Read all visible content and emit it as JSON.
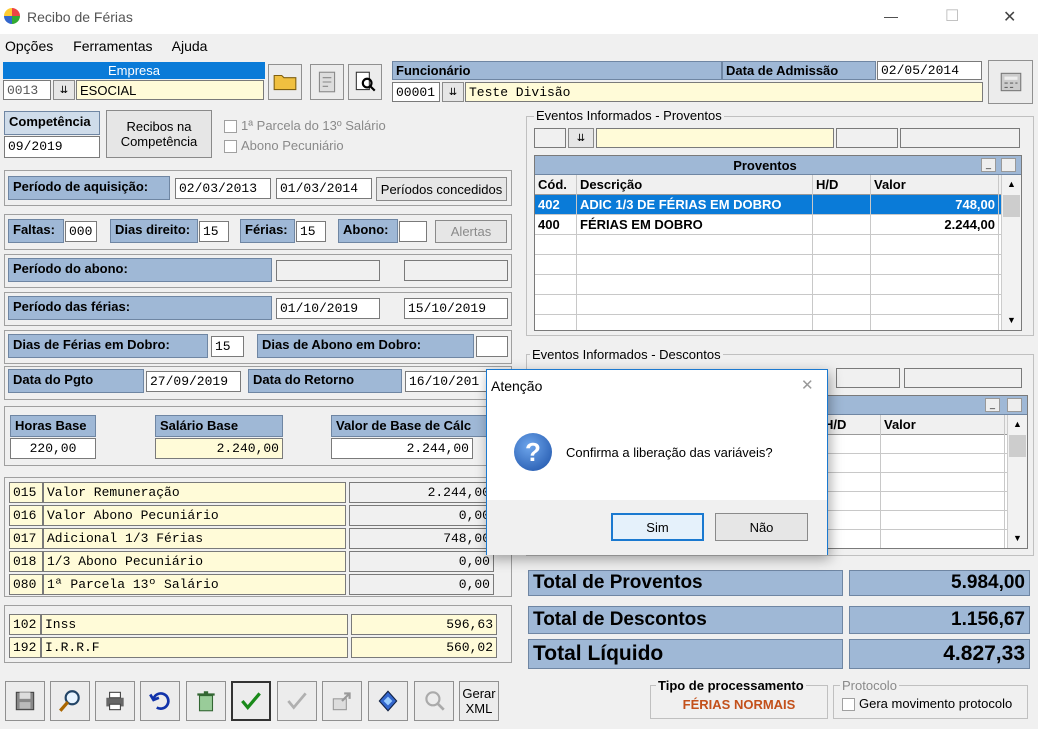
{
  "window": {
    "title": "Recibo de Férias",
    "minimize": "—",
    "maximize": "☐",
    "close": "✕"
  },
  "menu": [
    "Opções",
    "Ferramentas",
    "Ajuda"
  ],
  "empresa": {
    "header": "Empresa",
    "code": "0013",
    "name": "ESOCIAL"
  },
  "funcionario": {
    "header": "Funcionário",
    "code": "00001",
    "name": "Teste Divisão",
    "admissao_label": "Data de Admissão",
    "admissao": "02/05/2014"
  },
  "competencia": {
    "label": "Competência",
    "value": "09/2019",
    "recibos_btn": "Recibos na Competência",
    "parcela13": "1ª Parcela do 13º Salário",
    "abono": "Abono Pecuniário"
  },
  "aquisicao": {
    "label": "Período de aquisição:",
    "start": "02/03/2013",
    "end": "01/03/2014",
    "btn": "Períodos concedidos"
  },
  "dias": {
    "faltas_label": "Faltas:",
    "faltas": "000",
    "direito_label": "Dias direito:",
    "direito": "15",
    "ferias_label": "Férias:",
    "ferias": "15",
    "abono_label": "Abono:",
    "abono": "",
    "alertas_btn": "Alertas"
  },
  "abono_periodo": {
    "label": "Período do abono:",
    "start": "",
    "end": ""
  },
  "ferias_periodo": {
    "label": "Período das férias:",
    "start": "01/10/2019",
    "end": "15/10/2019"
  },
  "dobro": {
    "ferias_label": "Dias de Férias em Dobro:",
    "ferias": "15",
    "abono_label": "Dias de Abono em Dobro:",
    "abono": ""
  },
  "pagamento": {
    "pgto_label": "Data do Pgto",
    "pgto": "27/09/2019",
    "retorno_label": "Data do Retorno",
    "retorno": "16/10/201"
  },
  "base": {
    "horas_label": "Horas Base",
    "horas": "220,00",
    "salario_label": "Salário Base",
    "salario": "2.240,00",
    "calc_label": "Valor de Base de Cálc",
    "calc": "2.244,00"
  },
  "verbas": [
    {
      "code": "015",
      "desc": "Valor Remuneração",
      "value": "2.244,00"
    },
    {
      "code": "016",
      "desc": "Valor Abono Pecuniário",
      "value": "0,00"
    },
    {
      "code": "017",
      "desc": "Adicional 1/3 Férias",
      "value": "748,00"
    },
    {
      "code": "018",
      "desc": "1/3 Abono Pecuniário",
      "value": "0,00"
    },
    {
      "code": "080",
      "desc": "1ª Parcela 13º Salário",
      "value": "0,00"
    }
  ],
  "descontos_list": [
    {
      "code": "102",
      "desc": "Inss",
      "value": "596,63"
    },
    {
      "code": "192",
      "desc": "I.R.R.F",
      "value": "560,02"
    }
  ],
  "proventos": {
    "group_label": "Eventos Informados - Proventos",
    "title": "Proventos",
    "cols": [
      "Cód.",
      "Descrição",
      "H/D",
      "Valor"
    ],
    "rows": [
      {
        "cod": "402",
        "desc": "ADIC 1/3 DE FÉRIAS EM DOBRO",
        "hd": "",
        "valor": "748,00"
      },
      {
        "cod": "400",
        "desc": "FÉRIAS EM DOBRO",
        "hd": "",
        "valor": "2.244,00"
      }
    ]
  },
  "descontos_grid": {
    "group_label": "Eventos Informados - Descontos",
    "cols": [
      "H/D",
      "Valor"
    ]
  },
  "totais": {
    "proventos_label": "Total de Proventos",
    "proventos": "5.984,00",
    "descontos_label": "Total de Descontos",
    "descontos": "1.156,67",
    "liquido_label": "Total Líquido",
    "liquido": "4.827,33"
  },
  "toolbar": {
    "gerar_xml": "Gerar XML"
  },
  "processamento": {
    "label": "Tipo de processamento",
    "value": "FÉRIAS NORMAIS"
  },
  "protocolo": {
    "label": "Protocolo",
    "checkbox": "Gera movimento protocolo"
  },
  "dialog": {
    "title": "Atenção",
    "message": "Confirma a liberação das variáveis?",
    "yes": "Sim",
    "no": "Não",
    "close": "✕"
  }
}
